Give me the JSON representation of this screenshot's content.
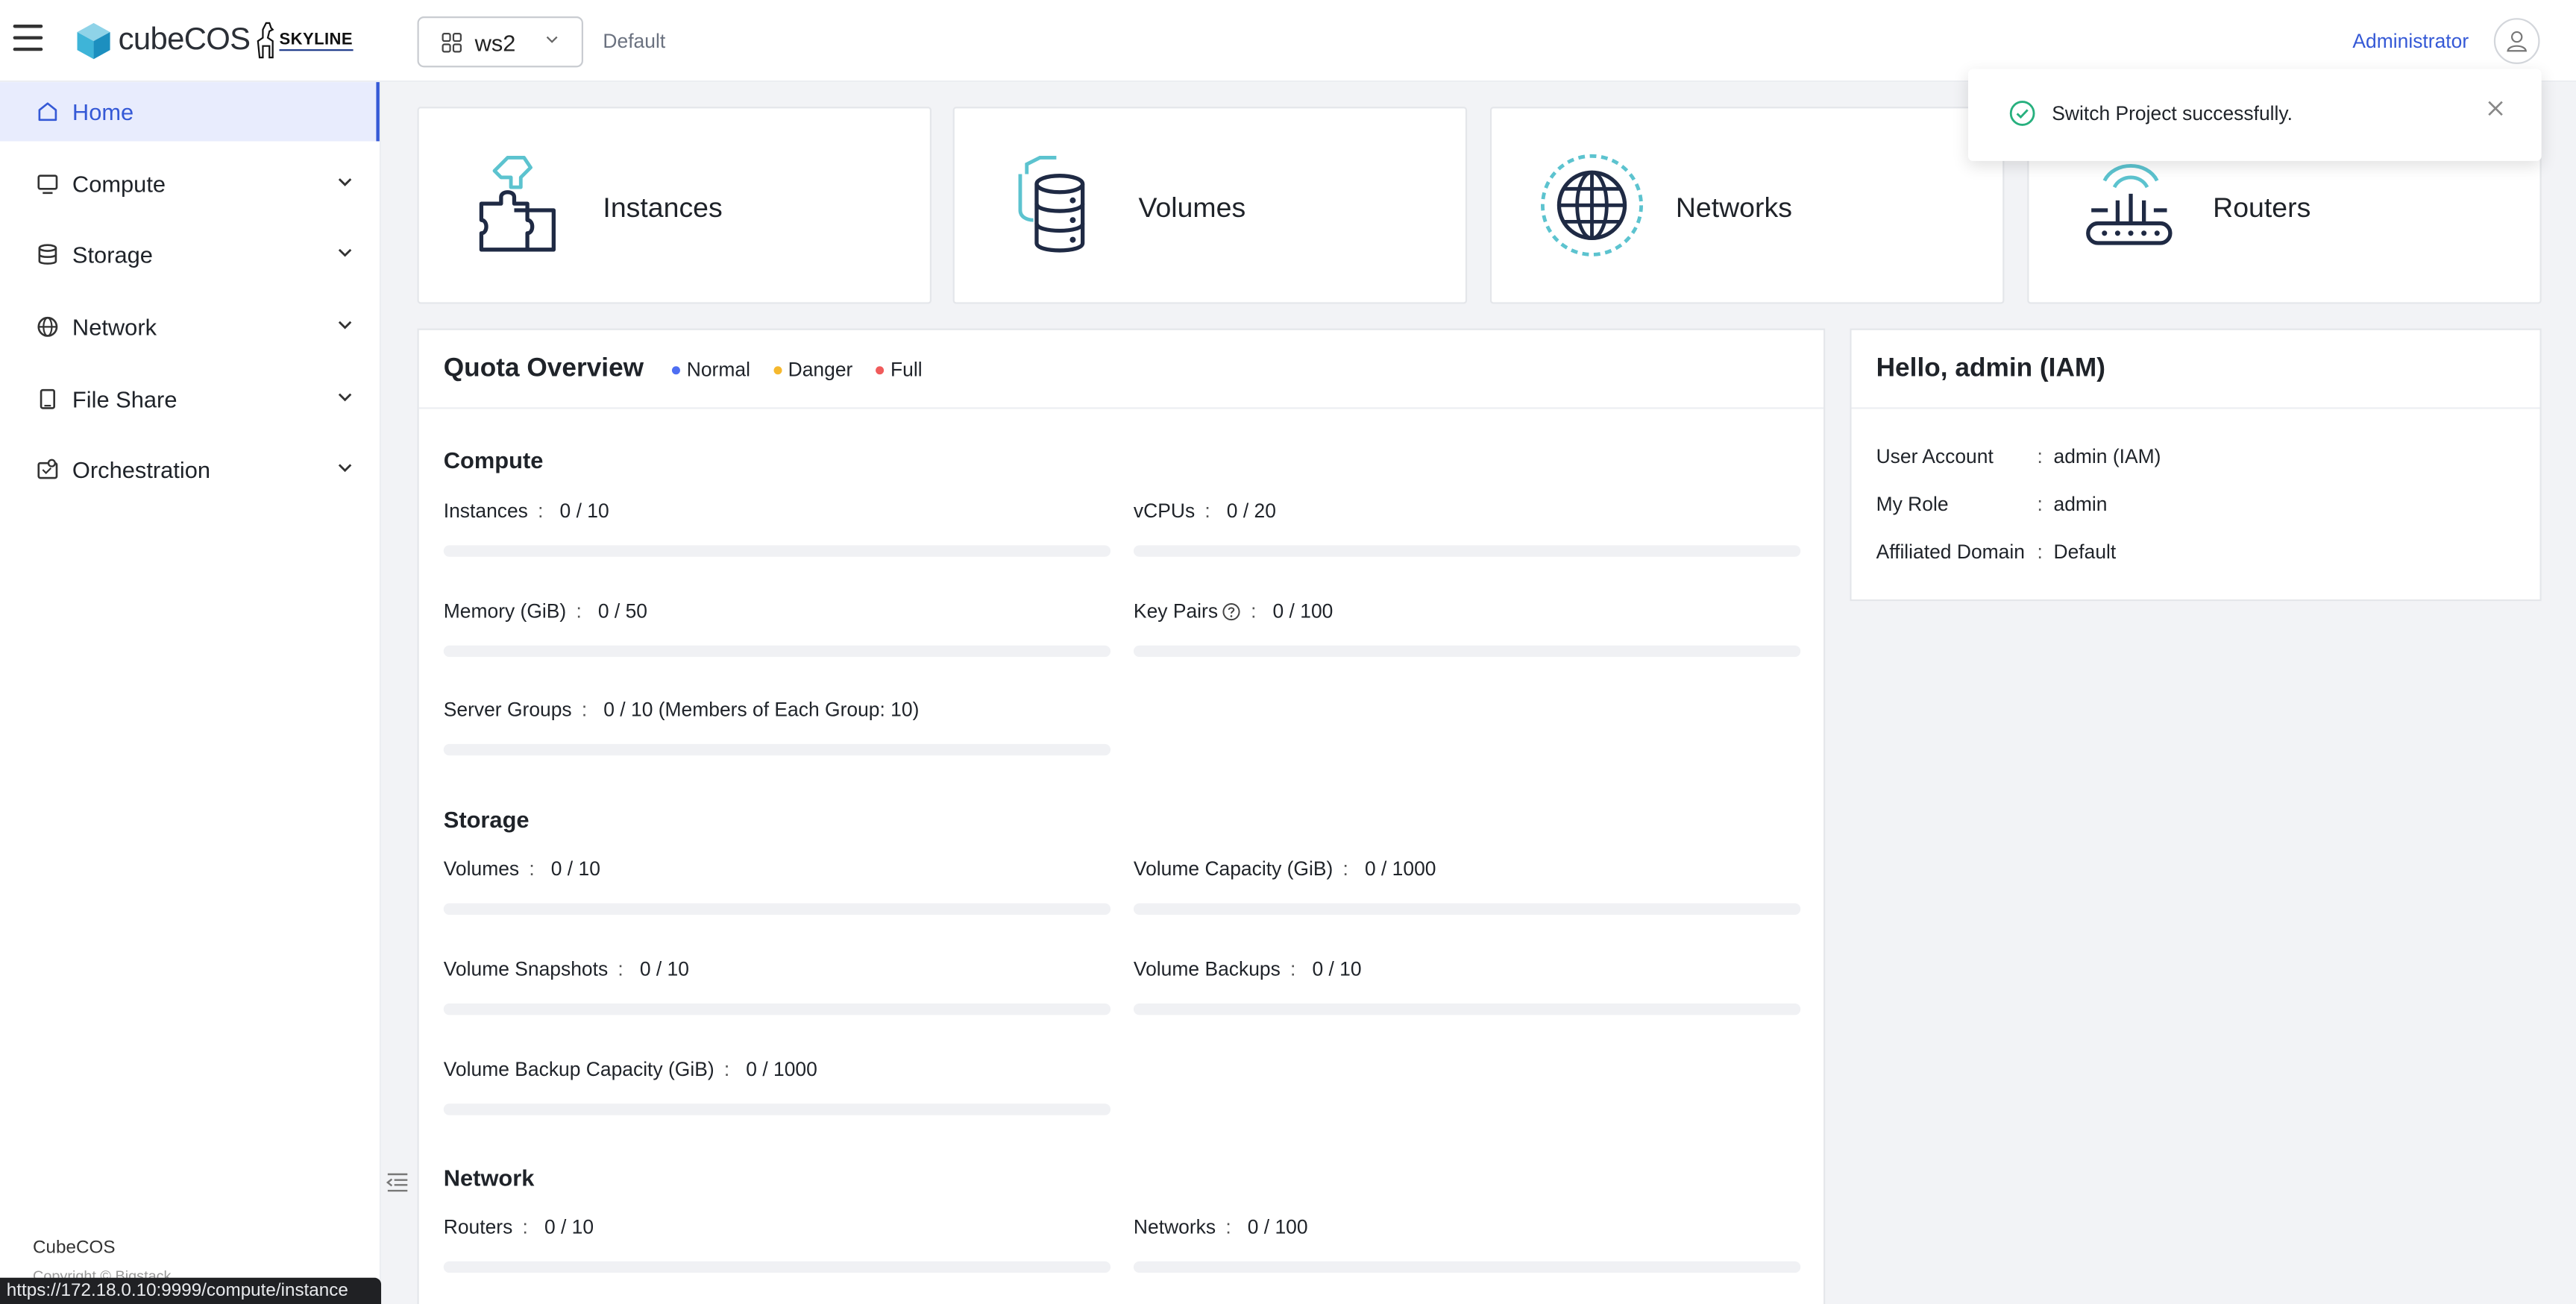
{
  "header": {
    "logo_text": "cubeCOS",
    "skyline_text": "SKYLINE",
    "project": "ws2",
    "domain": "Default",
    "user_link": "Administrator"
  },
  "sidebar": {
    "items": [
      {
        "label": "Home",
        "icon": "home-icon",
        "active": true
      },
      {
        "label": "Compute",
        "icon": "monitor-icon"
      },
      {
        "label": "Storage",
        "icon": "database-icon"
      },
      {
        "label": "Network",
        "icon": "globe-icon"
      },
      {
        "label": "File Share",
        "icon": "file-icon"
      },
      {
        "label": "Orchestration",
        "icon": "orchestration-icon"
      }
    ],
    "footer_brand": "CubeCOS",
    "footer_copy": "Copyright © Bigstack"
  },
  "status_url": "https://172.18.0.10:9999/compute/instance",
  "cards": [
    {
      "label": "Instances",
      "icon": "puzzle-icon"
    },
    {
      "label": "Volumes",
      "icon": "volume-stack-icon"
    },
    {
      "label": "Networks",
      "icon": "network-globe-icon"
    },
    {
      "label": "Routers",
      "icon": "router-icon"
    }
  ],
  "quota": {
    "title": "Quota Overview",
    "legend": [
      {
        "label": "Normal",
        "color": "#4e6ef2"
      },
      {
        "label": "Danger",
        "color": "#f5b82e"
      },
      {
        "label": "Full",
        "color": "#f05b5b"
      }
    ],
    "sections": {
      "compute": {
        "title": "Compute",
        "items": [
          {
            "label": "Instances",
            "value": "0 / 10",
            "used": 0
          },
          {
            "label": "vCPUs",
            "value": "0 / 20",
            "used": 0
          },
          {
            "label": "Memory (GiB)",
            "value": "0 / 50",
            "used": 0
          },
          {
            "label": "Key Pairs",
            "value": "0 / 100",
            "used": 0,
            "help": true
          },
          {
            "label": "Server Groups",
            "value": "0 / 10 (Members of Each Group: 10)",
            "used": 0
          }
        ]
      },
      "storage": {
        "title": "Storage",
        "items": [
          {
            "label": "Volumes",
            "value": "0 / 10",
            "used": 0
          },
          {
            "label": "Volume Capacity (GiB)",
            "value": "0 / 1000",
            "used": 0
          },
          {
            "label": "Volume Snapshots",
            "value": "0 / 10",
            "used": 0
          },
          {
            "label": "Volume Backups",
            "value": "0 / 10",
            "used": 0
          },
          {
            "label": "Volume Backup Capacity (GiB)",
            "value": "0 / 1000",
            "used": 0
          }
        ]
      },
      "network": {
        "title": "Network",
        "items": [
          {
            "label": "Routers",
            "value": "0 / 10",
            "used": 0
          },
          {
            "label": "Networks",
            "value": "0 / 100",
            "used": 0
          }
        ]
      }
    }
  },
  "hello": {
    "title": "Hello, admin (IAM)",
    "rows": [
      {
        "key": "User Account",
        "value": "admin (IAM)"
      },
      {
        "key": "My Role",
        "value": "admin"
      },
      {
        "key": "Affiliated Domain",
        "value": "Default"
      }
    ]
  },
  "toast": {
    "message": "Switch Project successfully."
  }
}
